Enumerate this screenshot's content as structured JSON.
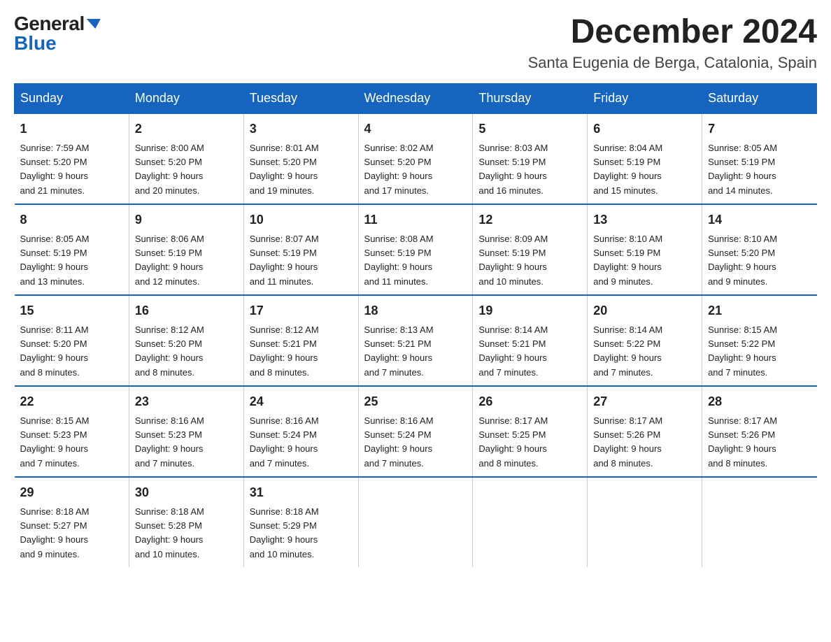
{
  "header": {
    "logo_general": "General",
    "logo_blue": "Blue",
    "month_title": "December 2024",
    "location": "Santa Eugenia de Berga, Catalonia, Spain"
  },
  "days_of_week": [
    "Sunday",
    "Monday",
    "Tuesday",
    "Wednesday",
    "Thursday",
    "Friday",
    "Saturday"
  ],
  "weeks": [
    [
      {
        "day": "1",
        "sunrise": "Sunrise: 7:59 AM",
        "sunset": "Sunset: 5:20 PM",
        "daylight": "Daylight: 9 hours",
        "daylight2": "and 21 minutes."
      },
      {
        "day": "2",
        "sunrise": "Sunrise: 8:00 AM",
        "sunset": "Sunset: 5:20 PM",
        "daylight": "Daylight: 9 hours",
        "daylight2": "and 20 minutes."
      },
      {
        "day": "3",
        "sunrise": "Sunrise: 8:01 AM",
        "sunset": "Sunset: 5:20 PM",
        "daylight": "Daylight: 9 hours",
        "daylight2": "and 19 minutes."
      },
      {
        "day": "4",
        "sunrise": "Sunrise: 8:02 AM",
        "sunset": "Sunset: 5:20 PM",
        "daylight": "Daylight: 9 hours",
        "daylight2": "and 17 minutes."
      },
      {
        "day": "5",
        "sunrise": "Sunrise: 8:03 AM",
        "sunset": "Sunset: 5:19 PM",
        "daylight": "Daylight: 9 hours",
        "daylight2": "and 16 minutes."
      },
      {
        "day": "6",
        "sunrise": "Sunrise: 8:04 AM",
        "sunset": "Sunset: 5:19 PM",
        "daylight": "Daylight: 9 hours",
        "daylight2": "and 15 minutes."
      },
      {
        "day": "7",
        "sunrise": "Sunrise: 8:05 AM",
        "sunset": "Sunset: 5:19 PM",
        "daylight": "Daylight: 9 hours",
        "daylight2": "and 14 minutes."
      }
    ],
    [
      {
        "day": "8",
        "sunrise": "Sunrise: 8:05 AM",
        "sunset": "Sunset: 5:19 PM",
        "daylight": "Daylight: 9 hours",
        "daylight2": "and 13 minutes."
      },
      {
        "day": "9",
        "sunrise": "Sunrise: 8:06 AM",
        "sunset": "Sunset: 5:19 PM",
        "daylight": "Daylight: 9 hours",
        "daylight2": "and 12 minutes."
      },
      {
        "day": "10",
        "sunrise": "Sunrise: 8:07 AM",
        "sunset": "Sunset: 5:19 PM",
        "daylight": "Daylight: 9 hours",
        "daylight2": "and 11 minutes."
      },
      {
        "day": "11",
        "sunrise": "Sunrise: 8:08 AM",
        "sunset": "Sunset: 5:19 PM",
        "daylight": "Daylight: 9 hours",
        "daylight2": "and 11 minutes."
      },
      {
        "day": "12",
        "sunrise": "Sunrise: 8:09 AM",
        "sunset": "Sunset: 5:19 PM",
        "daylight": "Daylight: 9 hours",
        "daylight2": "and 10 minutes."
      },
      {
        "day": "13",
        "sunrise": "Sunrise: 8:10 AM",
        "sunset": "Sunset: 5:19 PM",
        "daylight": "Daylight: 9 hours",
        "daylight2": "and 9 minutes."
      },
      {
        "day": "14",
        "sunrise": "Sunrise: 8:10 AM",
        "sunset": "Sunset: 5:20 PM",
        "daylight": "Daylight: 9 hours",
        "daylight2": "and 9 minutes."
      }
    ],
    [
      {
        "day": "15",
        "sunrise": "Sunrise: 8:11 AM",
        "sunset": "Sunset: 5:20 PM",
        "daylight": "Daylight: 9 hours",
        "daylight2": "and 8 minutes."
      },
      {
        "day": "16",
        "sunrise": "Sunrise: 8:12 AM",
        "sunset": "Sunset: 5:20 PM",
        "daylight": "Daylight: 9 hours",
        "daylight2": "and 8 minutes."
      },
      {
        "day": "17",
        "sunrise": "Sunrise: 8:12 AM",
        "sunset": "Sunset: 5:21 PM",
        "daylight": "Daylight: 9 hours",
        "daylight2": "and 8 minutes."
      },
      {
        "day": "18",
        "sunrise": "Sunrise: 8:13 AM",
        "sunset": "Sunset: 5:21 PM",
        "daylight": "Daylight: 9 hours",
        "daylight2": "and 7 minutes."
      },
      {
        "day": "19",
        "sunrise": "Sunrise: 8:14 AM",
        "sunset": "Sunset: 5:21 PM",
        "daylight": "Daylight: 9 hours",
        "daylight2": "and 7 minutes."
      },
      {
        "day": "20",
        "sunrise": "Sunrise: 8:14 AM",
        "sunset": "Sunset: 5:22 PM",
        "daylight": "Daylight: 9 hours",
        "daylight2": "and 7 minutes."
      },
      {
        "day": "21",
        "sunrise": "Sunrise: 8:15 AM",
        "sunset": "Sunset: 5:22 PM",
        "daylight": "Daylight: 9 hours",
        "daylight2": "and 7 minutes."
      }
    ],
    [
      {
        "day": "22",
        "sunrise": "Sunrise: 8:15 AM",
        "sunset": "Sunset: 5:23 PM",
        "daylight": "Daylight: 9 hours",
        "daylight2": "and 7 minutes."
      },
      {
        "day": "23",
        "sunrise": "Sunrise: 8:16 AM",
        "sunset": "Sunset: 5:23 PM",
        "daylight": "Daylight: 9 hours",
        "daylight2": "and 7 minutes."
      },
      {
        "day": "24",
        "sunrise": "Sunrise: 8:16 AM",
        "sunset": "Sunset: 5:24 PM",
        "daylight": "Daylight: 9 hours",
        "daylight2": "and 7 minutes."
      },
      {
        "day": "25",
        "sunrise": "Sunrise: 8:16 AM",
        "sunset": "Sunset: 5:24 PM",
        "daylight": "Daylight: 9 hours",
        "daylight2": "and 7 minutes."
      },
      {
        "day": "26",
        "sunrise": "Sunrise: 8:17 AM",
        "sunset": "Sunset: 5:25 PM",
        "daylight": "Daylight: 9 hours",
        "daylight2": "and 8 minutes."
      },
      {
        "day": "27",
        "sunrise": "Sunrise: 8:17 AM",
        "sunset": "Sunset: 5:26 PM",
        "daylight": "Daylight: 9 hours",
        "daylight2": "and 8 minutes."
      },
      {
        "day": "28",
        "sunrise": "Sunrise: 8:17 AM",
        "sunset": "Sunset: 5:26 PM",
        "daylight": "Daylight: 9 hours",
        "daylight2": "and 8 minutes."
      }
    ],
    [
      {
        "day": "29",
        "sunrise": "Sunrise: 8:18 AM",
        "sunset": "Sunset: 5:27 PM",
        "daylight": "Daylight: 9 hours",
        "daylight2": "and 9 minutes."
      },
      {
        "day": "30",
        "sunrise": "Sunrise: 8:18 AM",
        "sunset": "Sunset: 5:28 PM",
        "daylight": "Daylight: 9 hours",
        "daylight2": "and 10 minutes."
      },
      {
        "day": "31",
        "sunrise": "Sunrise: 8:18 AM",
        "sunset": "Sunset: 5:29 PM",
        "daylight": "Daylight: 9 hours",
        "daylight2": "and 10 minutes."
      },
      null,
      null,
      null,
      null
    ]
  ]
}
